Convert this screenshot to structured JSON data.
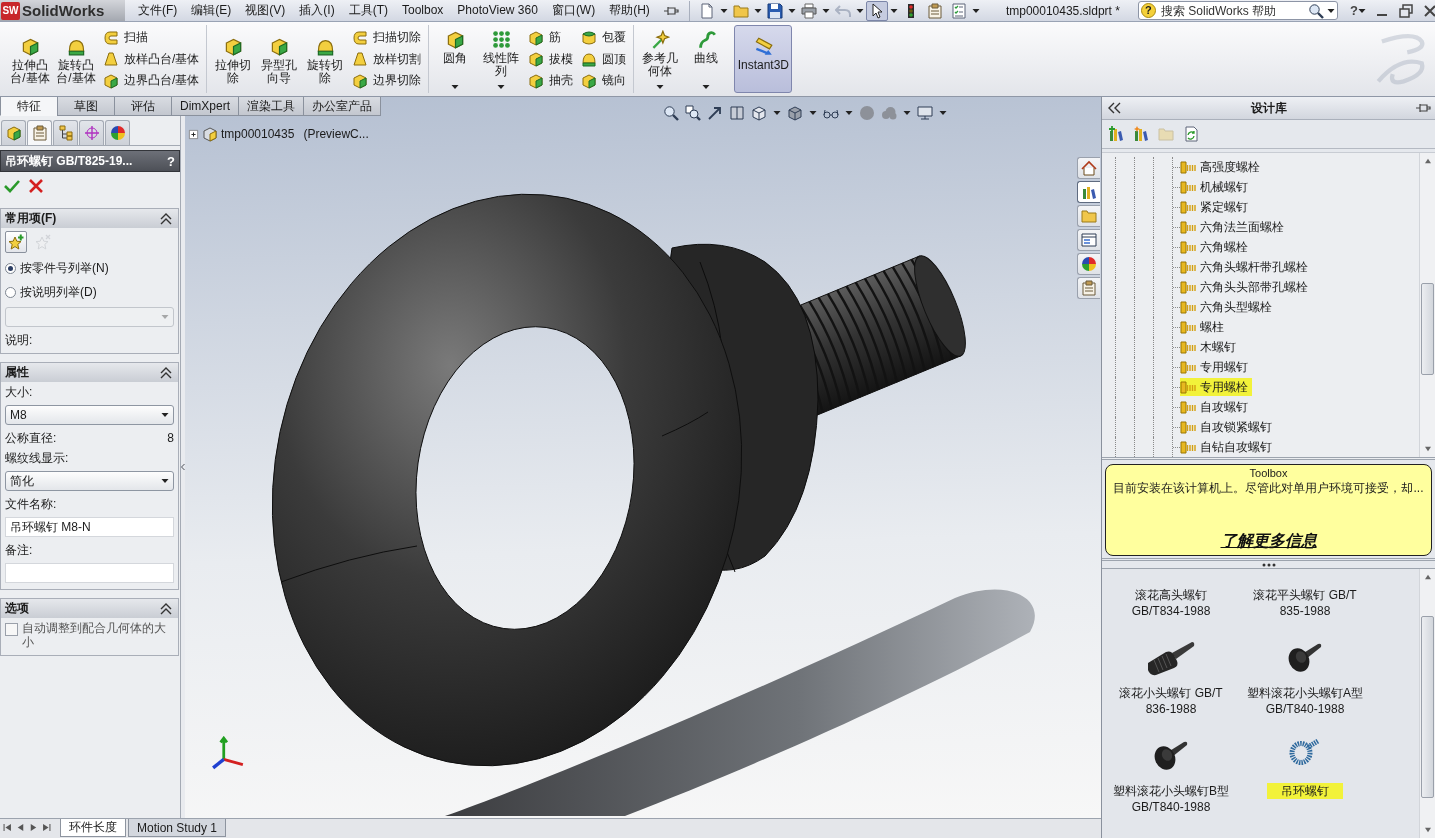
{
  "app": {
    "logo_mark": "SW",
    "logo": "SolidWorks",
    "document_title": "tmp00010435.sldprt *",
    "help": "?"
  },
  "menu": [
    "文件(F)",
    "编辑(E)",
    "视图(V)",
    "插入(I)",
    "工具(T)",
    "Toolbox",
    "PhotoView 360",
    "窗口(W)",
    "帮助(H)"
  ],
  "quick_access": [
    {
      "on": false,
      "disabled": false
    },
    {
      "on": false,
      "disabled": false
    },
    {
      "on": false,
      "disabled": false
    },
    {
      "on": false,
      "disabled": false
    },
    {
      "on": false,
      "disabled": true
    },
    {
      "on": true,
      "disabled": false
    },
    {
      "on": false,
      "disabled": false
    },
    {
      "on": false,
      "disabled": false
    },
    {
      "on": false,
      "disabled": false
    }
  ],
  "search": {
    "badge": "?",
    "placeholder": "搜索 SolidWorks 帮助"
  },
  "ribbon": {
    "groups": [
      [
        {
          "kind": "large",
          "label": "拉伸凸台/基体",
          "dropdown": false,
          "on": false
        },
        {
          "kind": "large",
          "label": "旋转凸台/基体",
          "dropdown": false,
          "on": false
        },
        {
          "kind": "stack",
          "items": [
            "扫描",
            "放样凸台/基体",
            "边界凸台/基体"
          ]
        }
      ],
      [
        {
          "kind": "large",
          "label": "拉伸切除",
          "dropdown": false,
          "on": false
        },
        {
          "kind": "large",
          "label": "异型孔向导",
          "dropdown": false,
          "on": false
        },
        {
          "kind": "large",
          "label": "旋转切除",
          "dropdown": false,
          "on": false
        },
        {
          "kind": "stack",
          "items": [
            "扫描切除",
            "放样切割",
            "边界切除"
          ]
        }
      ],
      [
        {
          "kind": "large",
          "label": "圆角",
          "dropdown": true,
          "on": false
        },
        {
          "kind": "large",
          "label": "线性阵列",
          "dropdown": true,
          "on": false
        },
        {
          "kind": "stack",
          "items": [
            "筋",
            "拔模",
            "抽壳"
          ]
        },
        {
          "kind": "stack",
          "items": [
            "包覆",
            "圆顶",
            "镜向"
          ]
        }
      ],
      [
        {
          "kind": "large",
          "label": "参考几何体",
          "dropdown": true,
          "on": false
        },
        {
          "kind": "large",
          "label": "曲线",
          "dropdown": true,
          "on": false
        },
        {
          "kind": "large",
          "label": "Instant3D",
          "dropdown": false,
          "on": true
        }
      ]
    ]
  },
  "command_tabs": [
    {
      "label": "特征",
      "selected": true
    },
    {
      "label": "草图",
      "selected": false
    },
    {
      "label": "评估",
      "selected": false
    },
    {
      "label": "DimXpert",
      "selected": false
    },
    {
      "label": "渲染工具",
      "selected": false
    },
    {
      "label": "办公室产品",
      "selected": false
    }
  ],
  "property_manager": {
    "tabs": [
      {
        "selected": false
      },
      {
        "selected": true
      },
      {
        "selected": false
      },
      {
        "selected": false
      },
      {
        "selected": false
      }
    ],
    "title": "吊环螺钉 GB/T825-19...",
    "help": "?",
    "sections": [
      {
        "title": "常用项(F)",
        "expanded": true,
        "items": [
          {
            "kind": "favorites",
            "remove_disabled": true
          },
          {
            "kind": "radio",
            "label": "按零件号列举(N)",
            "selected": true
          },
          {
            "kind": "radio",
            "label": "按说明列举(D)",
            "selected": false
          },
          {
            "kind": "select",
            "disabled": true
          },
          {
            "kind": "label",
            "label": "说明:"
          }
        ]
      },
      {
        "title": "属性",
        "expanded": true,
        "items": [
          {
            "kind": "label",
            "label": "大小:"
          },
          {
            "kind": "select",
            "value": "M8",
            "disabled": false
          },
          {
            "kind": "readout",
            "label": "公称直径:",
            "value": "8"
          },
          {
            "kind": "label",
            "label": "螺纹线显示:"
          },
          {
            "kind": "select",
            "value": "简化",
            "disabled": false
          },
          {
            "kind": "label",
            "label": "文件名称:"
          },
          {
            "kind": "text",
            "value": "吊环螺钉 M8-N"
          },
          {
            "kind": "label",
            "label": "备注:"
          },
          {
            "kind": "text"
          }
        ]
      },
      {
        "title": "选项",
        "expanded": true,
        "items": [
          {
            "kind": "checkbox",
            "label": "自动调整到配合几何体的大小",
            "checked": false
          }
        ]
      }
    ]
  },
  "graphics": {
    "tree": {
      "expanded": false,
      "name": "tmp00010435",
      "config": "(PreviewC..."
    },
    "task_tabs": [
      {
        "selected": false
      },
      {
        "selected": true
      },
      {
        "selected": false
      },
      {
        "selected": false
      },
      {
        "selected": false
      },
      {
        "selected": false
      }
    ]
  },
  "bottom_tabs": [
    {
      "label": "环件长度",
      "selected": true
    },
    {
      "label": "Motion Study 1",
      "selected": false
    }
  ],
  "design_library": {
    "title": "设计库",
    "toolbar": [
      {
        "disabled": false
      },
      {
        "disabled": false
      },
      {
        "disabled": true
      },
      {
        "disabled": false
      }
    ],
    "tree": [
      {
        "label": "高强度螺栓",
        "selected": false
      },
      {
        "label": "机械螺钉",
        "selected": false
      },
      {
        "label": "紧定螺钉",
        "selected": false
      },
      {
        "label": "六角法兰面螺栓",
        "selected": false
      },
      {
        "label": "六角螺栓",
        "selected": false
      },
      {
        "label": "六角头螺杆带孔螺栓",
        "selected": false
      },
      {
        "label": "六角头头部带孔螺栓",
        "selected": false
      },
      {
        "label": "六角头型螺栓",
        "selected": false
      },
      {
        "label": "螺柱",
        "selected": false
      },
      {
        "label": "木螺钉",
        "selected": false
      },
      {
        "label": "专用螺钉",
        "selected": false
      },
      {
        "label": "专用螺栓",
        "selected": true
      },
      {
        "label": "自攻螺钉",
        "selected": false
      },
      {
        "label": "自攻锁紧螺钉",
        "selected": false
      },
      {
        "label": "自钻自攻螺钉",
        "selected": false
      }
    ],
    "notice": {
      "title": "Toolbox",
      "message": "目前安装在该计算机上。尽管此对单用户环境可接受，却...",
      "link": "了解更多信息"
    },
    "items": [
      {
        "kind": "caption",
        "label": "滚花高头螺钉\nGB/T834-1988",
        "selected": false
      },
      {
        "kind": "caption",
        "label": "滚花平头螺钉 GB/T\n835-1988",
        "selected": false
      },
      {
        "kind": "knurled",
        "label": "滚花小头螺钉 GB/T\n836-1988",
        "selected": false
      },
      {
        "kind": "thumb",
        "label": "塑料滚花小头螺钉A型\nGB/T840-1988",
        "selected": false
      },
      {
        "kind": "thumb",
        "label": "塑料滚花小头螺钉B型\nGB/T840-1988",
        "selected": false
      },
      {
        "kind": "eye",
        "label": "吊环螺钉",
        "selected": true
      }
    ]
  }
}
